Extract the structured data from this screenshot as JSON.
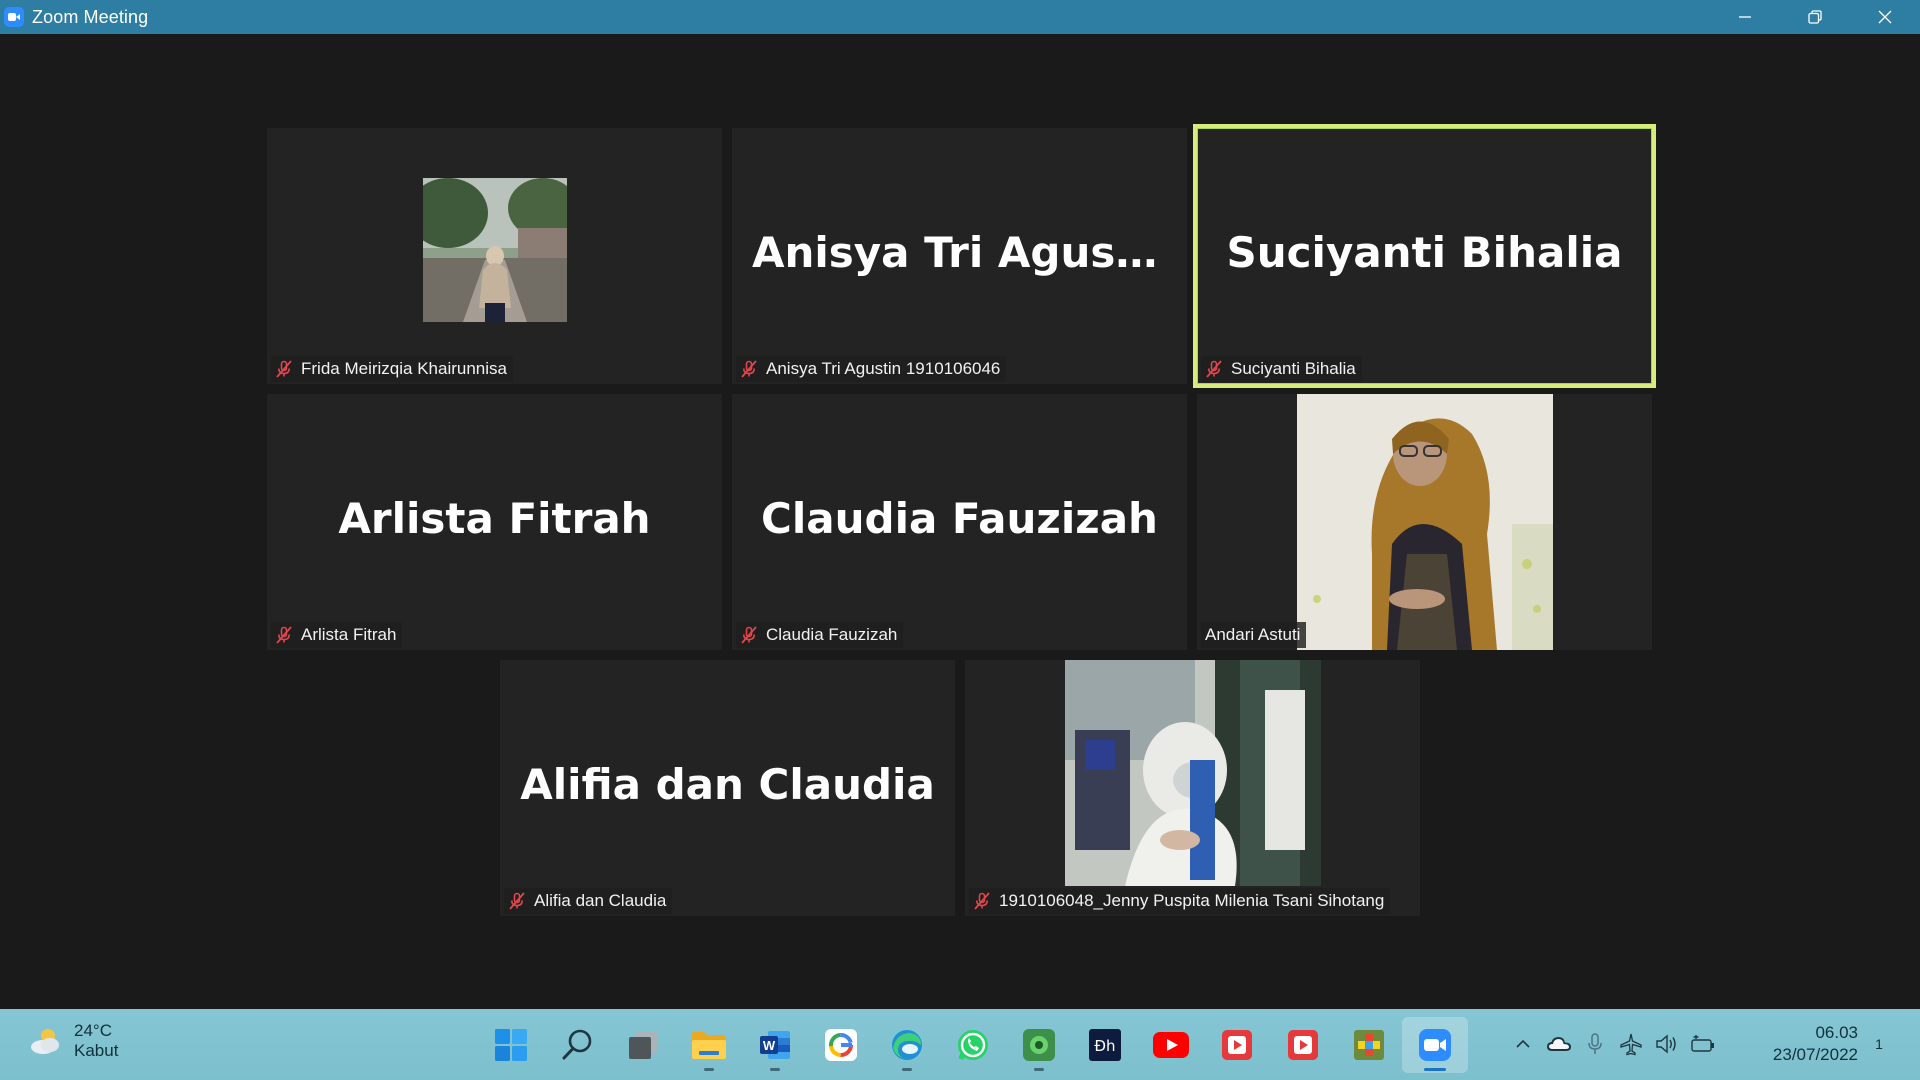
{
  "window": {
    "title": "Zoom Meeting",
    "controls": [
      "minimize-icon",
      "restore-icon",
      "close-icon"
    ]
  },
  "colors": {
    "titlebar": "#2e7ea4",
    "meeting_bg": "#1a1a1a",
    "tile_bg": "#232323",
    "active_speaker_border": "#d6ec7c",
    "mic_off": "#e0474c",
    "taskbar": "#80c4d2"
  },
  "participants": [
    {
      "big_name": "",
      "tag": "Frida Meirizqia Khairunnisa",
      "muted": true,
      "video": "profile-photo"
    },
    {
      "big_name": "Anisya Tri Agusti...",
      "tag": "Anisya Tri Agustin 1910106046",
      "muted": true
    },
    {
      "big_name": "Suciyanti Bihalia",
      "tag": "Suciyanti Bihalia",
      "muted": true,
      "active_speaker": true
    },
    {
      "big_name": "Arlista Fitrah",
      "tag": "Arlista Fitrah",
      "muted": true
    },
    {
      "big_name": "Claudia Fauzizah",
      "tag": "Claudia Fauzizah",
      "muted": true
    },
    {
      "big_name": "",
      "tag": "Andari Astuti",
      "muted": false,
      "video": "camera-video"
    },
    {
      "big_name": "Alifia dan Claudia",
      "tag": "Alifia dan Claudia",
      "muted": true
    },
    {
      "big_name": "",
      "tag": "1910106048_Jenny Puspita Milenia Tsani Sihotang",
      "muted": true,
      "video": "camera-video"
    }
  ],
  "taskbar": {
    "weather": {
      "temp": "24°C",
      "condition": "Kabut",
      "icon": "partly-cloudy-icon"
    },
    "apps": [
      {
        "name": "start-icon",
        "running": false
      },
      {
        "name": "search-icon",
        "running": false
      },
      {
        "name": "task-view-icon",
        "running": false
      },
      {
        "name": "file-explorer-icon",
        "running": true
      },
      {
        "name": "word-icon",
        "running": true
      },
      {
        "name": "google-icon",
        "running": false
      },
      {
        "name": "edge-icon",
        "running": true
      },
      {
        "name": "whatsapp-icon",
        "running": false
      },
      {
        "name": "green-app-icon",
        "running": true
      },
      {
        "name": "dh-app-icon",
        "running": false
      },
      {
        "name": "youtube-icon",
        "running": false
      },
      {
        "name": "video-player-icon",
        "running": false
      },
      {
        "name": "video-player-2-icon",
        "running": false
      },
      {
        "name": "puzzle-app-icon",
        "running": false
      },
      {
        "name": "zoom-icon",
        "running": true,
        "active": true
      }
    ],
    "tray": [
      "chevron-up-icon",
      "cloud-icon",
      "microphone-icon",
      "airplane-icon",
      "volume-icon",
      "battery-icon"
    ],
    "time": "06.03",
    "date": "23/07/2022",
    "notifications": "1"
  }
}
